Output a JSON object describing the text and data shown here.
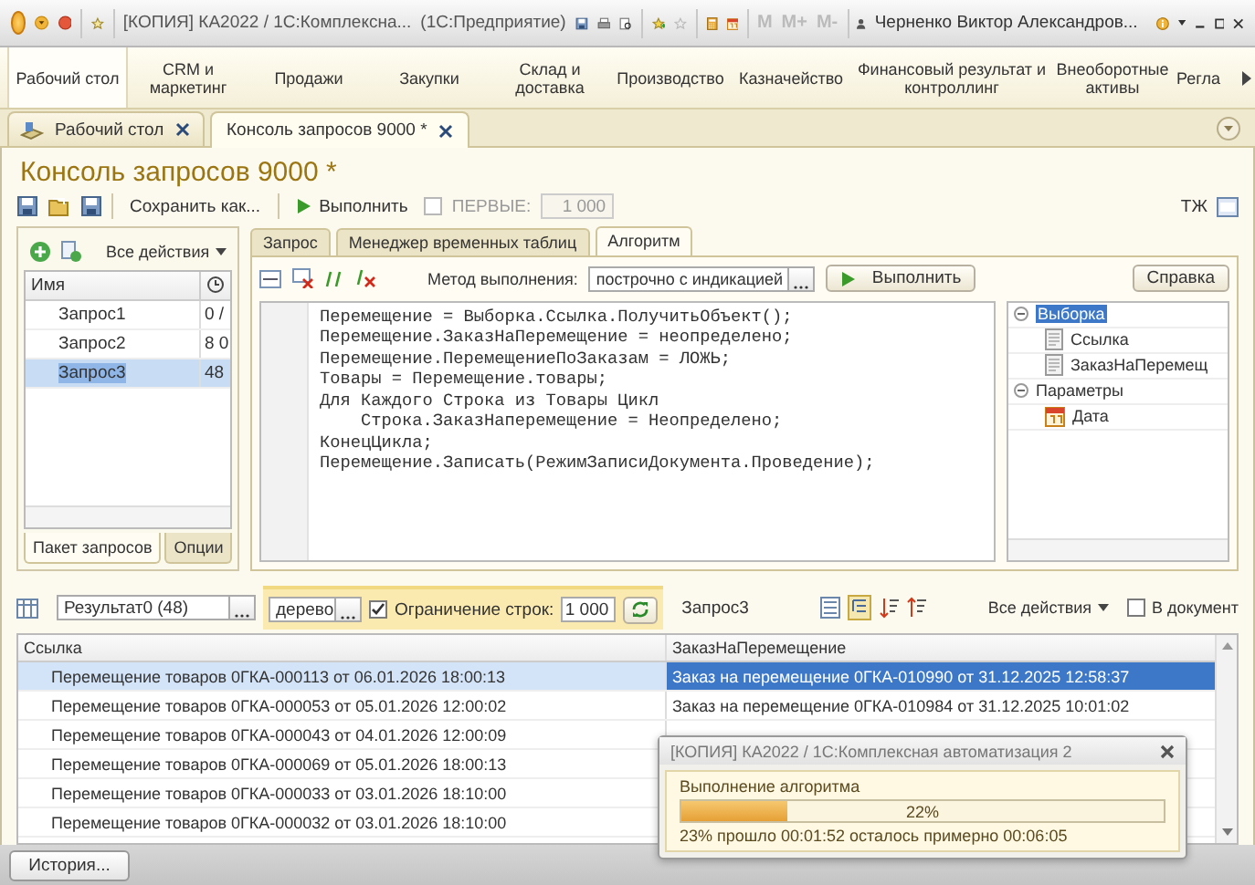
{
  "window": {
    "title": "[КОПИЯ] КА2022 / 1С:Комплексна...",
    "app": "(1С:Предприятие)",
    "memory_buttons": [
      "M",
      "M+",
      "M-"
    ],
    "user": "Черненко Виктор Александров..."
  },
  "sections": [
    {
      "label": "Рабочий стол",
      "selected": true
    },
    {
      "label": "CRM и маркетинг",
      "selected": false
    },
    {
      "label": "Продажи",
      "selected": false
    },
    {
      "label": "Закупки",
      "selected": false
    },
    {
      "label": "Склад и доставка",
      "selected": false
    },
    {
      "label": "Производство",
      "selected": false
    },
    {
      "label": "Казначейство",
      "selected": false
    },
    {
      "label": "Финансовый результат и контроллинг",
      "selected": false
    },
    {
      "label": "Внеоборотные активы",
      "selected": false
    },
    {
      "label": "Регла",
      "selected": false
    }
  ],
  "open_tabs": [
    {
      "label": "Рабочий стол",
      "selected": false
    },
    {
      "label": "Консоль запросов 9000 *",
      "selected": true
    }
  ],
  "form": {
    "title": "Консоль запросов 9000 *",
    "save_as": "Сохранить как...",
    "run": "Выполнить",
    "first_checkbox": {
      "label": "ПЕРВЫЕ:",
      "checked": false,
      "disabled": true
    },
    "first_value": "1 000",
    "tj": "ТЖ"
  },
  "query_list": {
    "actions": "Все действия",
    "columns": [
      "Имя"
    ],
    "rows": [
      {
        "name": "Запрос1",
        "value": "0 /",
        "selected": false
      },
      {
        "name": "Запрос2",
        "value": "8 0",
        "selected": false
      },
      {
        "name": "Запрос3",
        "value": "48",
        "selected": true
      }
    ],
    "tabs": [
      {
        "label": "Пакет запросов",
        "selected": true
      },
      {
        "label": "Опции",
        "selected": false
      }
    ]
  },
  "editor_tabs": [
    {
      "label": "Запрос",
      "selected": false
    },
    {
      "label": "Менеджер временных таблиц",
      "selected": false
    },
    {
      "label": "Алгоритм",
      "selected": true
    }
  ],
  "algorithm": {
    "method_label": "Метод выполнения:",
    "method_value": "построчно с индикацией",
    "run": "Выполнить",
    "help": "Справка",
    "code": [
      "Перемещение = Выборка.Ссылка.ПолучитьОбъект();",
      "Перемещение.ЗаказНаПеремещение = неопределено;",
      "Перемещение.ПеремещениеПоЗаказам = ЛОЖЬ;",
      "Товары = Перемещение.товары;",
      "Для Каждого Строка из Товары Цикл",
      "    Строка.ЗаказНаперемещение = Неопределено;",
      "КонецЦикла;",
      "Перемещение.Записать(РежимЗаписиДокумента.Проведение);"
    ]
  },
  "tree": [
    {
      "label": "Выборка",
      "expanded": true,
      "selected": true,
      "children": [
        {
          "label": "Ссылка",
          "kind": "field",
          "selected": false
        },
        {
          "label": "ЗаказНаПеремещ",
          "kind": "field",
          "selected": false
        }
      ]
    },
    {
      "label": "Параметры",
      "expanded": true,
      "selected": false,
      "children": [
        {
          "label": "Дата",
          "kind": "date",
          "selected": false
        }
      ]
    }
  ],
  "results": {
    "result_value": "Результат0 (48)",
    "view_value": "дерево",
    "limit_checkbox": {
      "label": "Ограничение строк:",
      "checked": true
    },
    "limit_value": "1 000",
    "query_name": "Запрос3",
    "actions": "Все действия",
    "to_document": {
      "label": "В документ",
      "checked": false
    }
  },
  "table": {
    "columns": [
      "Ссылка",
      "ЗаказНаПеремещение"
    ],
    "rows": [
      {
        "cells": [
          "Перемещение товаров 0ГКА-000113 от 06.01.2026 18:00:13",
          "Заказ на перемещение 0ГКА-010990 от 31.12.2025 12:58:37"
        ],
        "selected": true
      },
      {
        "cells": [
          "Перемещение товаров 0ГКА-000053 от 05.01.2026 12:00:02",
          "Заказ на перемещение 0ГКА-010984 от 31.12.2025 10:01:02"
        ],
        "selected": false
      },
      {
        "cells": [
          "Перемещение товаров 0ГКА-000043 от 04.01.2026 12:00:09"
        ],
        "selected": false
      },
      {
        "cells": [
          "Перемещение товаров 0ГКА-000069 от 05.01.2026 18:00:13"
        ],
        "selected": false
      },
      {
        "cells": [
          "Перемещение товаров 0ГКА-000033 от 03.01.2026 18:10:00"
        ],
        "selected": false
      },
      {
        "cells": [
          "Перемещение товаров 0ГКА-000032 от 03.01.2026 18:10:00"
        ],
        "selected": false
      }
    ]
  },
  "progress_dialog": {
    "title": "[КОПИЯ] КА2022 / 1С:Комплексная автоматизация 2",
    "caption": "Выполнение алгоритма",
    "level": 0.22,
    "reading": "22%",
    "status": "23% прошло 00:01:52 осталось примерно 00:06:05"
  },
  "status_bar": {
    "history_button": "История..."
  }
}
